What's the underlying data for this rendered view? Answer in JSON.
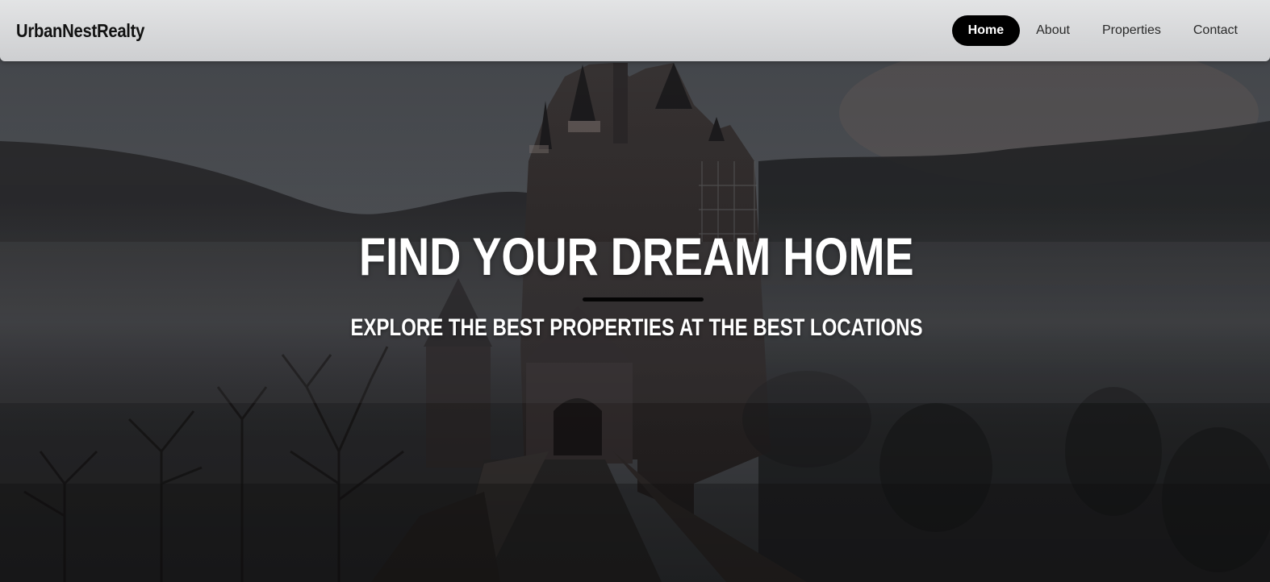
{
  "brand": {
    "name": "UrbanNestRealty"
  },
  "nav": {
    "items": [
      {
        "label": "Home",
        "active": true
      },
      {
        "label": "About",
        "active": false
      },
      {
        "label": "Properties",
        "active": false
      },
      {
        "label": "Contact",
        "active": false
      }
    ]
  },
  "hero": {
    "title": "FIND YOUR DREAM HOME",
    "subtitle": "EXPLORE THE BEST PROPERTIES AT THE BEST LOCATIONS"
  },
  "colors": {
    "nav_active_bg": "#000000",
    "nav_bg": "#e3e4e5",
    "hero_text": "#ffffff",
    "divider": "#050505"
  }
}
